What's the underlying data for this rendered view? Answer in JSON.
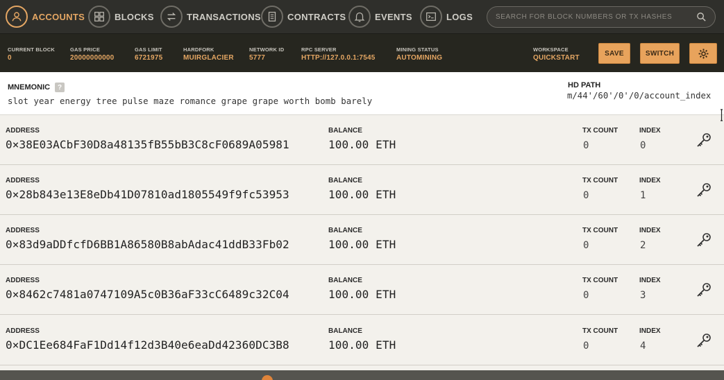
{
  "nav": {
    "items": [
      {
        "label": "ACCOUNTS",
        "icon": "user-icon",
        "active": true
      },
      {
        "label": "BLOCKS",
        "icon": "blocks-icon",
        "active": false
      },
      {
        "label": "TRANSACTIONS",
        "icon": "transfer-icon",
        "active": false
      },
      {
        "label": "CONTRACTS",
        "icon": "document-icon",
        "active": false
      },
      {
        "label": "EVENTS",
        "icon": "bell-icon",
        "active": false
      },
      {
        "label": "LOGS",
        "icon": "terminal-icon",
        "active": false
      }
    ],
    "search_placeholder": "SEARCH FOR BLOCK NUMBERS OR TX HASHES"
  },
  "status": {
    "current_block_label": "CURRENT BLOCK",
    "current_block_value": "0",
    "gas_price_label": "GAS PRICE",
    "gas_price_value": "20000000000",
    "gas_limit_label": "GAS LIMIT",
    "gas_limit_value": "6721975",
    "hardfork_label": "HARDFORK",
    "hardfork_value": "MUIRGLACIER",
    "network_id_label": "NETWORK ID",
    "network_id_value": "5777",
    "rpc_server_label": "RPC SERVER",
    "rpc_server_value": "HTTP://127.0.0.1:7545",
    "mining_status_label": "MINING STATUS",
    "mining_status_value": "AUTOMINING",
    "workspace_label": "WORKSPACE",
    "workspace_value": "QUICKSTART",
    "save_label": "SAVE",
    "switch_label": "SWITCH"
  },
  "mnemonic": {
    "label": "MNEMONIC",
    "help": "?",
    "words": "slot year energy tree pulse maze romance grape grape worth bomb barely",
    "hd_path_label": "HD PATH",
    "hd_path_value": "m/44'/60'/0'/0/account_index"
  },
  "accounts": [
    {
      "address_label": "ADDRESS",
      "address": "0×38E03ACbF30D8a48135fB55bB3C8cF0689A05981",
      "balance_label": "BALANCE",
      "balance": "100.00 ETH",
      "tx_count_label": "TX COUNT",
      "tx_count": "0",
      "index_label": "INDEX",
      "index": "0"
    },
    {
      "address_label": "ADDRESS",
      "address": "0×28b843e13E8eDb41D07810ad1805549f9fc53953",
      "balance_label": "BALANCE",
      "balance": "100.00 ETH",
      "tx_count_label": "TX COUNT",
      "tx_count": "0",
      "index_label": "INDEX",
      "index": "1"
    },
    {
      "address_label": "ADDRESS",
      "address": "0×83d9aDDfcfD6BB1A86580B8abAdac41ddB33Fb02",
      "balance_label": "BALANCE",
      "balance": "100.00 ETH",
      "tx_count_label": "TX COUNT",
      "tx_count": "0",
      "index_label": "INDEX",
      "index": "2"
    },
    {
      "address_label": "ADDRESS",
      "address": "0×8462c7481a0747109A5c0B36aF33cC6489c32C04",
      "balance_label": "BALANCE",
      "balance": "100.00 ETH",
      "tx_count_label": "TX COUNT",
      "tx_count": "0",
      "index_label": "INDEX",
      "index": "3"
    },
    {
      "address_label": "ADDRESS",
      "address": "0×DC1Ee684FaF1Dd14f12d3B40e6eaDd42360DC3B8",
      "balance_label": "BALANCE",
      "balance": "100.00 ETH",
      "tx_count_label": "TX COUNT",
      "tx_count": "0",
      "index_label": "INDEX",
      "index": "4"
    }
  ],
  "colors": {
    "accent": "#e4a663",
    "nav_bg": "#2f2f2b",
    "status_bg": "#26261f",
    "row_bg": "#f3f1ec"
  }
}
